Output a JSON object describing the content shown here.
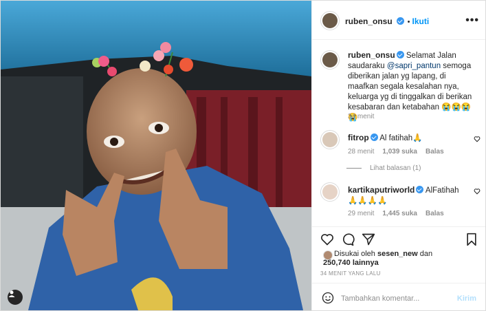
{
  "post": {
    "username": "ruben_onsu",
    "follow_label": "Ikuti",
    "more_label": "•••"
  },
  "caption": {
    "username": "ruben_onsu",
    "text_part1": "Selamat Jalan saudaraku",
    "mention": "@sapri_pantun",
    "text_part2": "semoga diberikan jalan yg lapang, di maafkan segala kesalahan nya, keluarga yg di tinggalkan di berikan kesabaran dan ketabahan",
    "emoji": "😭😭😭😭",
    "time": "34 menit"
  },
  "comments": [
    {
      "username": "fitrop",
      "text": "Al fatihah",
      "emoji": "🙏",
      "time": "28 menit",
      "likes": "1,039 suka",
      "reply": "Balas",
      "view_replies": "Lihat balasan (1)"
    },
    {
      "username": "kartikaputriworld",
      "text": "AlFatihah",
      "emoji": "🙏🙏🙏🙏",
      "time": "29 menit",
      "likes": "1,445 suka",
      "reply": "Balas"
    }
  ],
  "likes": {
    "prefix": "Disukai oleh",
    "user": "sesen_new",
    "joiner": "dan",
    "count": "250,740 lainnya"
  },
  "timestamp": "34 MENIT YANG LALU",
  "add_comment": {
    "placeholder": "Tambahkan komentar...",
    "post_label": "Kirim"
  },
  "colors": {
    "accent": "#0095f6",
    "verified": "#3897f0",
    "muted": "#8e8e8e"
  }
}
